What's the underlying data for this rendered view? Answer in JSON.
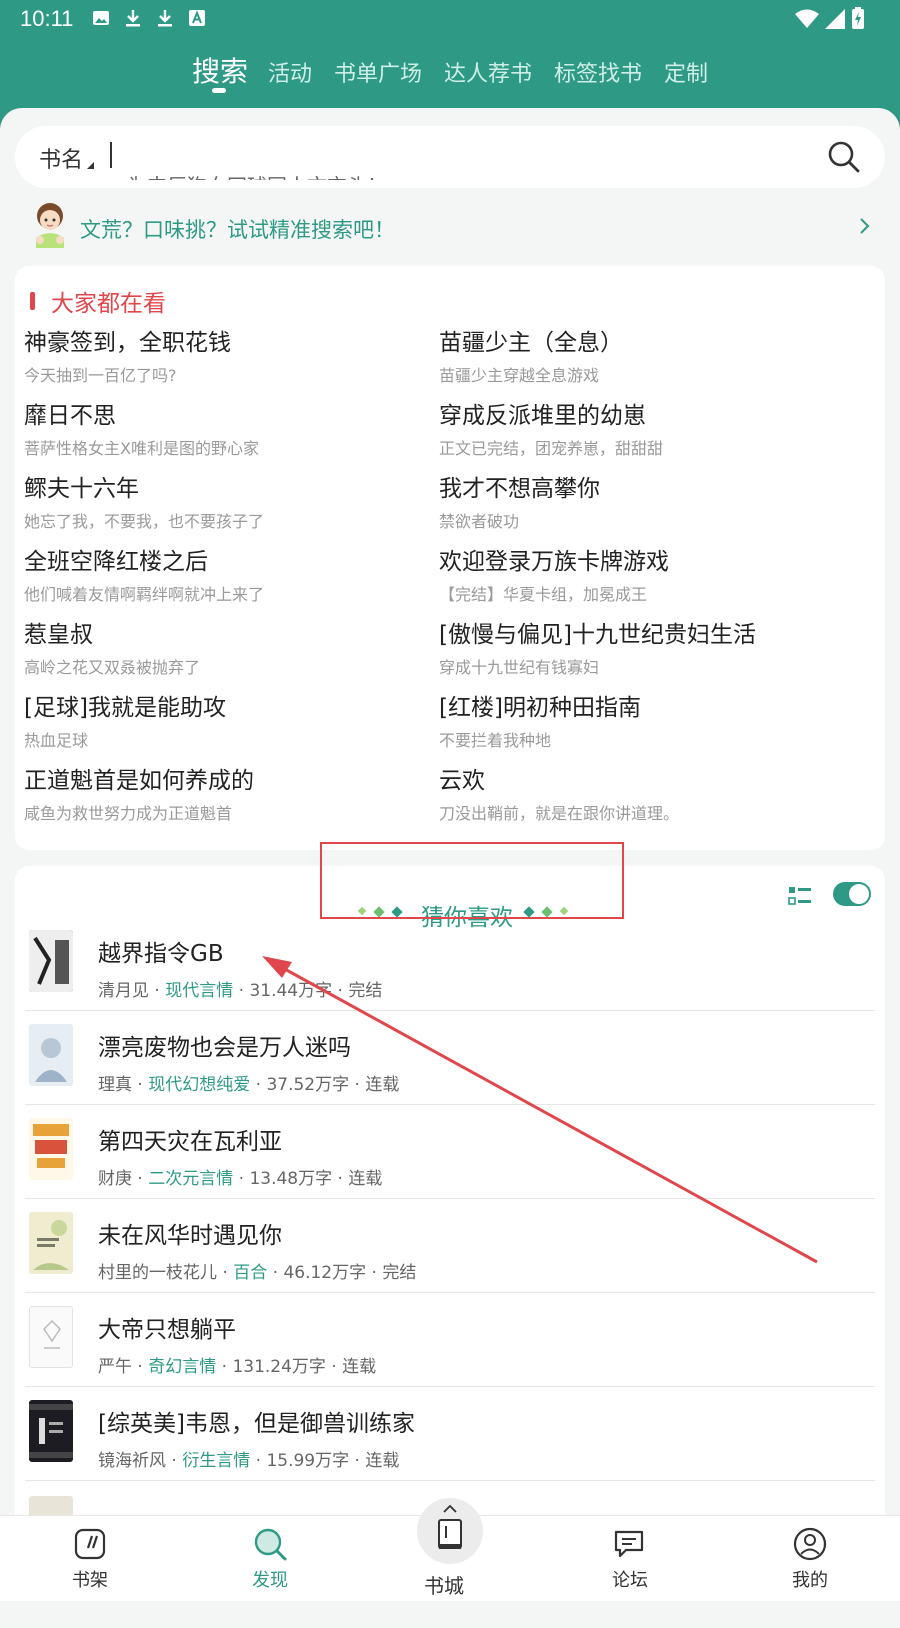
{
  "status_bar": {
    "time": "10:11"
  },
  "top_tabs": [
    "搜索",
    "活动",
    "书单广场",
    "达人荐书",
    "标签找书",
    "定制"
  ],
  "search": {
    "category": "书名",
    "placeholder": "为丰巨狗血网球同人文交头！"
  },
  "precise_hint": "文荒？口味挑？试试精准搜索吧！",
  "popular": {
    "title": "大家都在看",
    "items": [
      {
        "title": "神豪签到，全职花钱",
        "sub": "今天抽到一百亿了吗?"
      },
      {
        "title": "苗疆少主（全息）",
        "sub": "苗疆少主穿越全息游戏"
      },
      {
        "title": "靡日不思",
        "sub": "菩萨性格女主X唯利是图的野心家"
      },
      {
        "title": "穿成反派堆里的幼崽",
        "sub": "正文已完结，团宠养崽，甜甜甜"
      },
      {
        "title": "鳏夫十六年",
        "sub": "她忘了我，不要我，也不要孩子了"
      },
      {
        "title": "我才不想高攀你",
        "sub": "禁欲者破功"
      },
      {
        "title": "全班空降红楼之后",
        "sub": "他们喊着友情啊羁绊啊就冲上来了"
      },
      {
        "title": "欢迎登录万族卡牌游戏",
        "sub": "【完结】华夏卡组，加冕成王"
      },
      {
        "title": "惹皇叔",
        "sub": "高岭之花又双叒被抛弃了"
      },
      {
        "title": "[傲慢与偏见]十九世纪贵妇生活",
        "sub": "穿成十九世纪有钱寡妇"
      },
      {
        "title": "[足球]我就是能助攻",
        "sub": "热血足球"
      },
      {
        "title": "[红楼]明初种田指南",
        "sub": "不要拦着我种地"
      },
      {
        "title": "正道魁首是如何养成的",
        "sub": "咸鱼为救世努力成为正道魁首"
      },
      {
        "title": "云欢",
        "sub": "刀没出鞘前，就是在跟你讲道理。"
      }
    ]
  },
  "guess": {
    "title": "猜你喜欢",
    "books": [
      {
        "title": "越界指令GB",
        "author": "清月见",
        "genre": "现代言情",
        "words": "31.44万字",
        "status": "完结",
        "cover": "#3a3a3a"
      },
      {
        "title": "漂亮废物也会是万人迷吗",
        "author": "理真",
        "genre": "现代幻想纯爱",
        "words": "37.52万字",
        "status": "连载",
        "cover": "#b8c7d6"
      },
      {
        "title": "第四天灾在瓦利亚",
        "author": "财庚",
        "genre": "二次元言情",
        "words": "13.48万字",
        "status": "连载",
        "cover": "#e7a23a"
      },
      {
        "title": "未在风华时遇见你",
        "author": "村里的一枝花儿",
        "genre": "百合",
        "words": "46.12万字",
        "status": "完结",
        "cover": "#e9e3b8"
      },
      {
        "title": "大帝只想躺平",
        "author": "严午",
        "genre": "奇幻言情",
        "words": "131.24万字",
        "status": "连载",
        "cover": "#f4f4f4"
      },
      {
        "title": "[综英美]韦恩，但是御兽训练家",
        "author": "镜海祈风",
        "genre": "衍生言情",
        "words": "15.99万字",
        "status": "连载",
        "cover": "#1c1c22"
      }
    ]
  },
  "bottom_nav": [
    "书架",
    "发现",
    "书城",
    "论坛",
    "我的"
  ],
  "colors": {
    "primary": "#2e9a86",
    "accent_red": "#e0474c"
  }
}
